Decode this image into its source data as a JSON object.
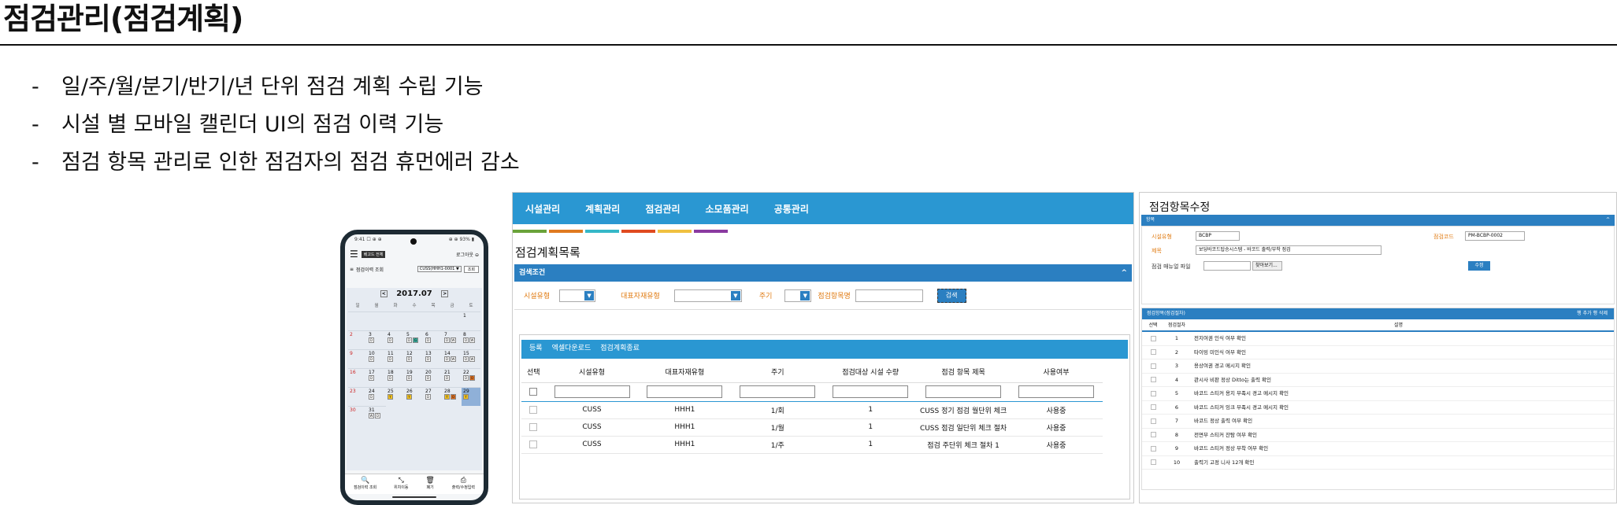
{
  "slide": {
    "title": "점검관리(점검계획)",
    "bullets": [
      "일/주/월/분기/반기/년 단위 점검 계획 수립 기능",
      "시설 별 모바일 캘린더 UI의 점검 이력 기능",
      "점검 항목 관리로 인한 점검자의 점검 휴먼에러 감소"
    ]
  },
  "mobile": {
    "status_left": "9:41 ☐ ⊕ ⊕",
    "status_right": "⊕ ⊕ 93% ▮",
    "badge": "베고드 전체",
    "logout": "로그아웃",
    "section": "점검이력 조회",
    "select_value": "CUSS(HHH1-0001 ▼",
    "query_button": "조회",
    "month": "2017.07",
    "prev": "<",
    "next": ">",
    "weekdays": [
      "일",
      "월",
      "화",
      "수",
      "목",
      "금",
      "토"
    ],
    "nav": [
      {
        "icon": "🔍",
        "label": "점검이력 조회"
      },
      {
        "icon": "⤡",
        "label": "위치이동"
      },
      {
        "icon": "🗑",
        "label": "폐기"
      },
      {
        "icon": "⎙",
        "label": "출력/수정입력"
      }
    ]
  },
  "main": {
    "nav": [
      "시설관리",
      "계획관리",
      "점검관리",
      "소모품관리",
      "공통관리"
    ],
    "stripe_colors": [
      "#6aa33a",
      "#e07a20",
      "#35b8c8",
      "#e04a20",
      "#f0c040",
      "#8a3aa0"
    ],
    "page_title": "점검계획목록",
    "condition_bar": "검색조건",
    "caret": "^",
    "filters": {
      "facility_type": "시설유형",
      "rep_type": "대표자재유형",
      "period": "주기",
      "item_name": "점검항목명",
      "search": "검색"
    },
    "list_actions": [
      "등록",
      "엑셀다운로드",
      "점검계획종료"
    ],
    "columns": [
      "선택",
      "시설유형",
      "대표자재유형",
      "주기",
      "점검대상 시설 수량",
      "점검 항목 제목",
      "사용여부"
    ],
    "rows": [
      [
        "CUSS",
        "HHH1",
        "1/회",
        "1",
        "CUSS 정기 점검 월단위 체크",
        "사용중"
      ],
      [
        "CUSS",
        "HHH1",
        "1/월",
        "1",
        "CUSS 점검 일단위 체크 절차",
        "사용중"
      ],
      [
        "CUSS",
        "HHH1",
        "1/주",
        "1",
        "점검 주단위 체크 절차 1",
        "사용중"
      ]
    ]
  },
  "edit": {
    "title": "점검항목수정",
    "bar": "항목",
    "caret": "^",
    "labels": {
      "facility": "시설유형",
      "code": "점검코드",
      "subject": "제목",
      "file": "점검 매뉴얼 파일"
    },
    "values": {
      "facility": "BCBP",
      "code": "PM-BCBP-0002",
      "subject": "보딩바코드탑승시스템 - 바코드 출력/부착 점검"
    },
    "browse": "찾아보기...",
    "save": "수정",
    "list_bar": "점검항목(점검절차)",
    "list_actions": "행 추가  행 삭제",
    "columns": [
      "선택",
      "점검절차",
      "",
      "설명"
    ],
    "items": [
      "전지여권 인식 여부 확인",
      "타이밍 미인식 여부 확인",
      "용상여권 경고 메시지 확인",
      "관시사 비판 정상 Ditto는 출력 확인",
      "바코드 스티커 용지 부족시 경고 메시지 확인",
      "바코드 스티커 잉크 부족시 경고 메시지 확인",
      "바코드 정상 출력 여부 확인",
      "전면부 스티커 잔탐 여부 확인",
      "바코드 스티커 정상 부착 여부 확인",
      "출력기 고정 니사 12개 확인"
    ]
  }
}
